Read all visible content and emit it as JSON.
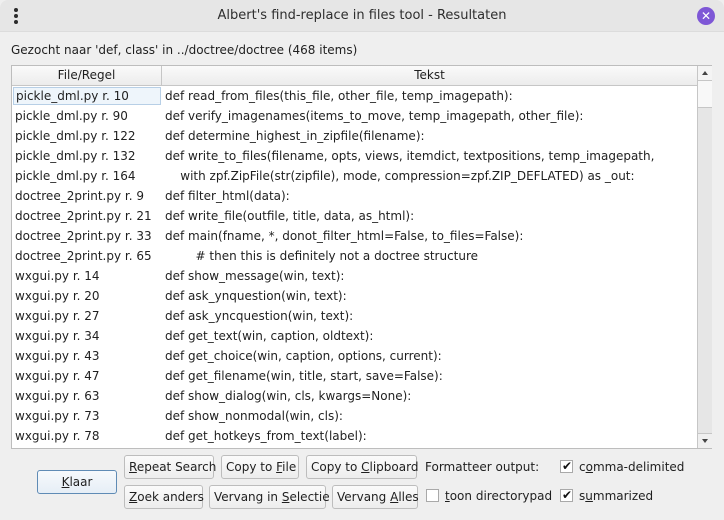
{
  "window": {
    "title": "Albert's find-replace in files tool - Resultaten",
    "menu_icon": "kebab-menu-icon",
    "close_icon": "close-icon",
    "close_glyph": "✕",
    "accent_color": "#7e57d6"
  },
  "summary": "Gezocht naar 'def, class' in ../doctree/doctree (468 items)",
  "table": {
    "columns": [
      "File/Regel",
      "Tekst"
    ],
    "rows": [
      {
        "file": "pickle_dml.py r. 10",
        "text": "def read_from_files(this_file, other_file, temp_imagepath):"
      },
      {
        "file": "pickle_dml.py r. 90",
        "text": "def verify_imagenames(items_to_move, temp_imagepath, other_file):"
      },
      {
        "file": "pickle_dml.py r. 122",
        "text": "def determine_highest_in_zipfile(filename):"
      },
      {
        "file": "pickle_dml.py r. 132",
        "text": "def write_to_files(filename, opts, views, itemdict, textpositions, temp_imagepath,"
      },
      {
        "file": "pickle_dml.py r. 164",
        "text": "    with zpf.ZipFile(str(zipfile), mode, compression=zpf.ZIP_DEFLATED) as _out:"
      },
      {
        "file": "doctree_2print.py r. 9",
        "text": "def filter_html(data):"
      },
      {
        "file": "doctree_2print.py r. 21",
        "text": "def write_file(outfile, title, data, as_html):"
      },
      {
        "file": "doctree_2print.py r. 33",
        "text": "def main(fname, *, donot_filter_html=False, to_files=False):"
      },
      {
        "file": "doctree_2print.py r. 65",
        "text": "        # then this is definitely not a doctree structure"
      },
      {
        "file": "wxgui.py r. 14",
        "text": "def show_message(win, text):"
      },
      {
        "file": "wxgui.py r. 20",
        "text": "def ask_ynquestion(win, text):"
      },
      {
        "file": "wxgui.py r. 27",
        "text": "def ask_yncquestion(win, text):"
      },
      {
        "file": "wxgui.py r. 34",
        "text": "def get_text(win, caption, oldtext):"
      },
      {
        "file": "wxgui.py r. 43",
        "text": "def get_choice(win, caption, options, current):"
      },
      {
        "file": "wxgui.py r. 47",
        "text": "def get_filename(win, title, start, save=False):"
      },
      {
        "file": "wxgui.py r. 63",
        "text": "def show_dialog(win, cls, kwargs=None):"
      },
      {
        "file": "wxgui.py r. 73",
        "text": "def show_nonmodal(win, cls):"
      },
      {
        "file": "wxgui.py r. 78",
        "text": "def get_hotkeys_from_text(label):"
      }
    ],
    "current_row": 0,
    "scrollbar": {
      "up_icon": "scroll-up-arrow-icon",
      "down_icon": "scroll-down-arrow-icon"
    }
  },
  "buttons": {
    "klaar": {
      "pre": "",
      "key": "K",
      "post": "laar"
    },
    "repeat_search": {
      "pre": "",
      "key": "R",
      "post": "epeat Search"
    },
    "copy_to_file": {
      "pre": "Copy to ",
      "key": "F",
      "post": "ile"
    },
    "copy_to_clipboard": {
      "pre": "Copy to ",
      "key": "C",
      "post": "lipboard"
    },
    "zoek_anders": {
      "pre": "",
      "key": "Z",
      "post": "oek anders"
    },
    "vervang_in_selectie": {
      "pre": "Vervang in ",
      "key": "S",
      "post": "electie"
    },
    "vervang_alles": {
      "pre": "Vervang ",
      "key": "A",
      "post": "lles"
    }
  },
  "options": {
    "format_label": "Formatteer output:",
    "comma_delimited": {
      "pre": "c",
      "key": "o",
      "post": "mma-delimited",
      "checked": true
    },
    "toon_directorypad": {
      "pre": "",
      "key": "t",
      "post": "oon directorypad",
      "checked": false
    },
    "summarized": {
      "pre": "s",
      "key": "u",
      "post": "mmarized",
      "checked": true
    },
    "check_glyph": "✔"
  }
}
